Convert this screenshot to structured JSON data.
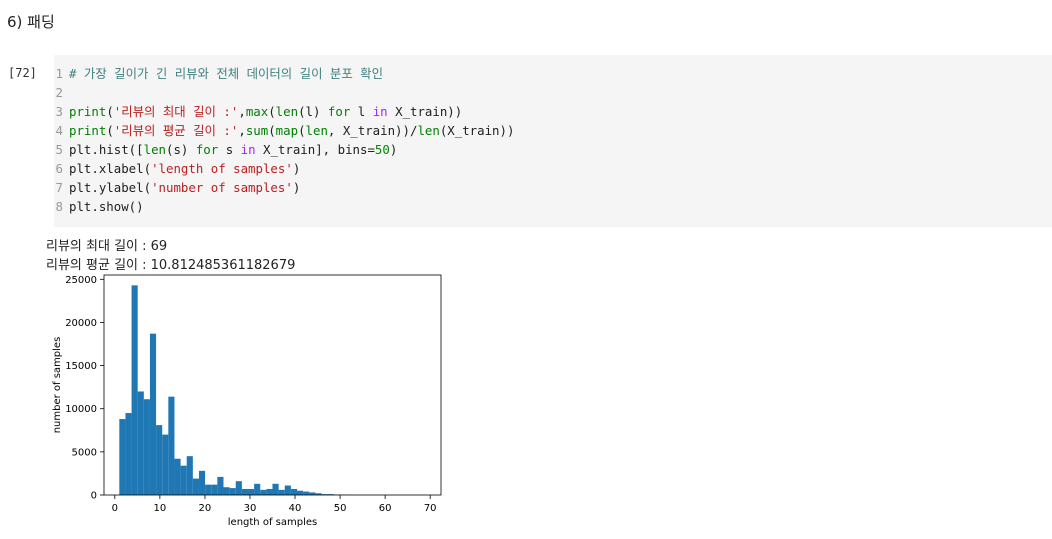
{
  "heading": "6) 패딩",
  "cell": {
    "prompt": "[72]",
    "lines": [
      {
        "n": "1",
        "tokens": [
          {
            "t": "# 가장 길이가 긴 리뷰와 전체 데이터의 길이 분포 확인",
            "c": "c-com"
          }
        ]
      },
      {
        "n": "2",
        "tokens": []
      },
      {
        "n": "3",
        "tokens": [
          {
            "t": "print",
            "c": "c-bi"
          },
          {
            "t": "(",
            "c": "c-id"
          },
          {
            "t": "'리뷰의 최대 길이 :'",
            "c": "c-str"
          },
          {
            "t": ",",
            "c": "c-id"
          },
          {
            "t": "max",
            "c": "c-bi"
          },
          {
            "t": "(",
            "c": "c-id"
          },
          {
            "t": "len",
            "c": "c-bi"
          },
          {
            "t": "(l) ",
            "c": "c-id"
          },
          {
            "t": "for",
            "c": "c-kw"
          },
          {
            "t": " l ",
            "c": "c-id"
          },
          {
            "t": "in",
            "c": "c-op"
          },
          {
            "t": " X_train))",
            "c": "c-id"
          }
        ]
      },
      {
        "n": "4",
        "tokens": [
          {
            "t": "print",
            "c": "c-bi"
          },
          {
            "t": "(",
            "c": "c-id"
          },
          {
            "t": "'리뷰의 평균 길이 :'",
            "c": "c-str"
          },
          {
            "t": ",",
            "c": "c-id"
          },
          {
            "t": "sum",
            "c": "c-bi"
          },
          {
            "t": "(",
            "c": "c-id"
          },
          {
            "t": "map",
            "c": "c-bi"
          },
          {
            "t": "(",
            "c": "c-id"
          },
          {
            "t": "len",
            "c": "c-bi"
          },
          {
            "t": ", X_train))/",
            "c": "c-id"
          },
          {
            "t": "len",
            "c": "c-bi"
          },
          {
            "t": "(X_train))",
            "c": "c-id"
          }
        ]
      },
      {
        "n": "5",
        "tokens": [
          {
            "t": "plt.hist([",
            "c": "c-id"
          },
          {
            "t": "len",
            "c": "c-bi"
          },
          {
            "t": "(s) ",
            "c": "c-id"
          },
          {
            "t": "for",
            "c": "c-kw"
          },
          {
            "t": " s ",
            "c": "c-id"
          },
          {
            "t": "in",
            "c": "c-op"
          },
          {
            "t": " X_train], bins=",
            "c": "c-id"
          },
          {
            "t": "50",
            "c": "c-num"
          },
          {
            "t": ")",
            "c": "c-id"
          }
        ]
      },
      {
        "n": "6",
        "tokens": [
          {
            "t": "plt.xlabel(",
            "c": "c-id"
          },
          {
            "t": "'length of samples'",
            "c": "c-str"
          },
          {
            "t": ")",
            "c": "c-id"
          }
        ]
      },
      {
        "n": "7",
        "tokens": [
          {
            "t": "plt.ylabel(",
            "c": "c-id"
          },
          {
            "t": "'number of samples'",
            "c": "c-str"
          },
          {
            "t": ")",
            "c": "c-id"
          }
        ]
      },
      {
        "n": "8",
        "tokens": [
          {
            "t": "plt.show()",
            "c": "c-id"
          }
        ]
      }
    ]
  },
  "output": {
    "line1": "리뷰의 최대 길이 : 69",
    "line2": "리뷰의 평균 길이 : 10.812485361182679"
  },
  "chart_data": {
    "type": "bar",
    "xlabel": "length of samples",
    "ylabel": "number of samples",
    "xlim": [
      -2.4,
      72.4
    ],
    "ylim": [
      0,
      25500
    ],
    "xticks": [
      0,
      10,
      20,
      30,
      40,
      50,
      60,
      70
    ],
    "yticks": [
      0,
      5000,
      10000,
      15000,
      20000,
      25000
    ],
    "bin_edges": [
      1,
      2.36,
      3.72,
      5.08,
      6.44,
      7.8,
      9.16,
      10.52,
      11.88,
      13.24,
      14.6,
      15.96,
      17.32,
      18.68,
      20.04,
      21.4,
      22.76,
      24.12,
      25.48,
      26.84,
      28.2,
      29.56,
      30.92,
      32.28,
      33.64,
      35,
      36.36,
      37.72,
      39.08,
      40.44,
      41.8,
      43.16,
      44.52,
      45.88,
      47.24,
      48.6,
      49.96,
      51.32,
      52.68,
      54.04,
      55.4,
      56.76,
      58.12,
      59.48,
      60.84,
      62.2,
      63.56,
      64.92,
      66.28,
      67.64,
      69
    ],
    "values": [
      8800,
      9500,
      24300,
      12000,
      11100,
      18700,
      8100,
      7000,
      11400,
      4200,
      3400,
      4500,
      1900,
      2800,
      1200,
      1200,
      2100,
      900,
      800,
      1600,
      700,
      700,
      1300,
      600,
      700,
      1300,
      600,
      1100,
      700,
      500,
      400,
      300,
      200,
      100,
      100,
      50,
      30,
      20,
      10,
      10,
      5,
      5,
      5,
      5,
      5,
      5,
      5,
      5,
      5,
      5
    ],
    "bar_color": "#1f77b4"
  }
}
